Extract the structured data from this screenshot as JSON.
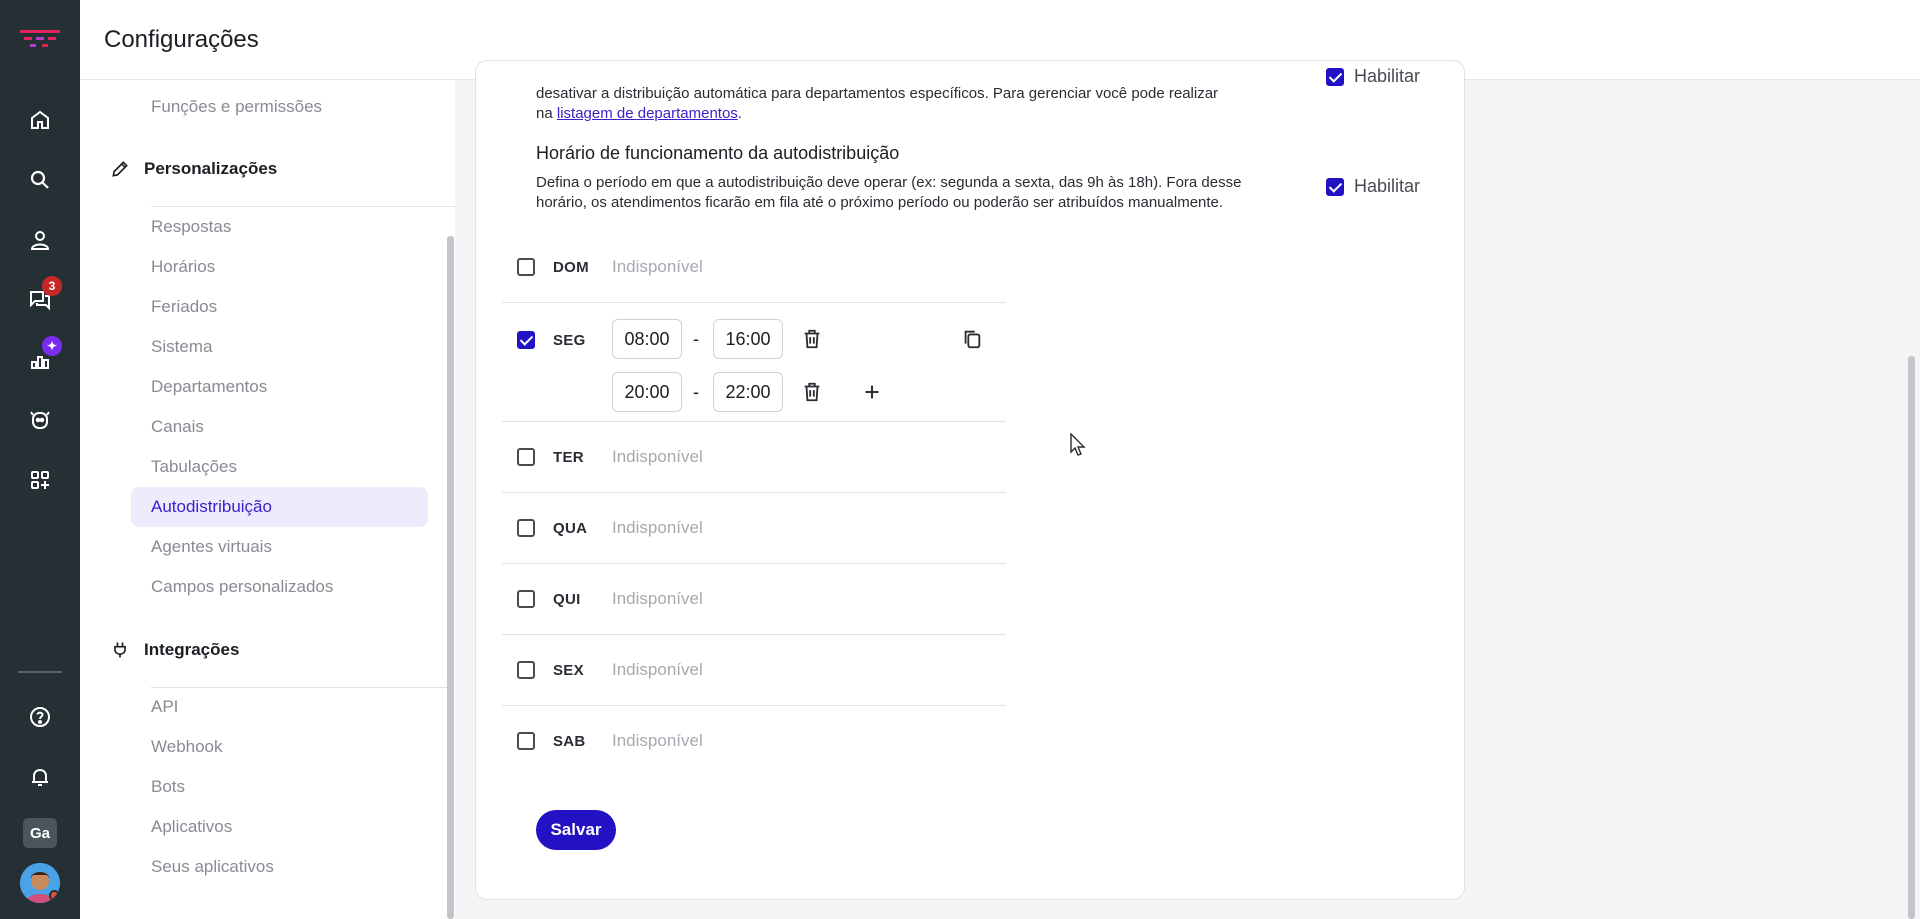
{
  "header": {
    "title": "Configurações"
  },
  "rail": {
    "logo": "brand-logo",
    "items": [
      {
        "name": "home-icon"
      },
      {
        "name": "search-icon"
      },
      {
        "name": "contacts-icon"
      },
      {
        "name": "chats-icon",
        "badge": "3"
      },
      {
        "name": "reports-icon",
        "badge": "✦"
      },
      {
        "name": "bot-icon"
      },
      {
        "name": "apps-icon"
      },
      {
        "name": "help-icon"
      },
      {
        "name": "bell-icon"
      }
    ],
    "org": "Ga",
    "brand_color": "#e0245e"
  },
  "sidebar": {
    "top_item": "Funções e permissões",
    "personalizacoes": {
      "title": "Personalizações",
      "items": [
        "Respostas",
        "Horários",
        "Feriados",
        "Sistema",
        "Departamentos",
        "Canais",
        "Tabulações",
        "Autodistribuição",
        "Agentes virtuais",
        "Campos personalizados"
      ],
      "active": "Autodistribuição"
    },
    "integracoes": {
      "title": "Integrações",
      "items": [
        "API",
        "Webhook",
        "Bots",
        "Aplicativos",
        "Seus aplicativos"
      ]
    }
  },
  "main": {
    "top_desc_line1": "desativar a distribuição automática para departamentos específicos. Para gerenciar você pode realizar",
    "top_desc_prefix": "na ",
    "top_desc_link": "listagem de departamentos",
    "top_desc_suffix": ".",
    "top_habilitar": "Habilitar",
    "schedule": {
      "title": "Horário de funcionamento da autodistribuição",
      "description": "Defina o período em que a autodistribuição deve operar (ex: segunda a sexta, das 9h às 18h). Fora desse horário, os atendimentos ficarão em fila até o próximo período ou poderão ser atribuídos manualmente.",
      "habilitar": "Habilitar",
      "unavailable": "Indisponível",
      "days": [
        {
          "label": "DOM",
          "enabled": false
        },
        {
          "label": "SEG",
          "enabled": true,
          "ranges": [
            {
              "start": "08:00",
              "end": "16:00"
            },
            {
              "start": "20:00",
              "end": "22:00"
            }
          ]
        },
        {
          "label": "TER",
          "enabled": false
        },
        {
          "label": "QUA",
          "enabled": false
        },
        {
          "label": "QUI",
          "enabled": false
        },
        {
          "label": "SEX",
          "enabled": false
        },
        {
          "label": "SAB",
          "enabled": false
        }
      ],
      "range_separator": "-"
    },
    "save_label": "Salvar",
    "accent_color": "#2311c4"
  }
}
